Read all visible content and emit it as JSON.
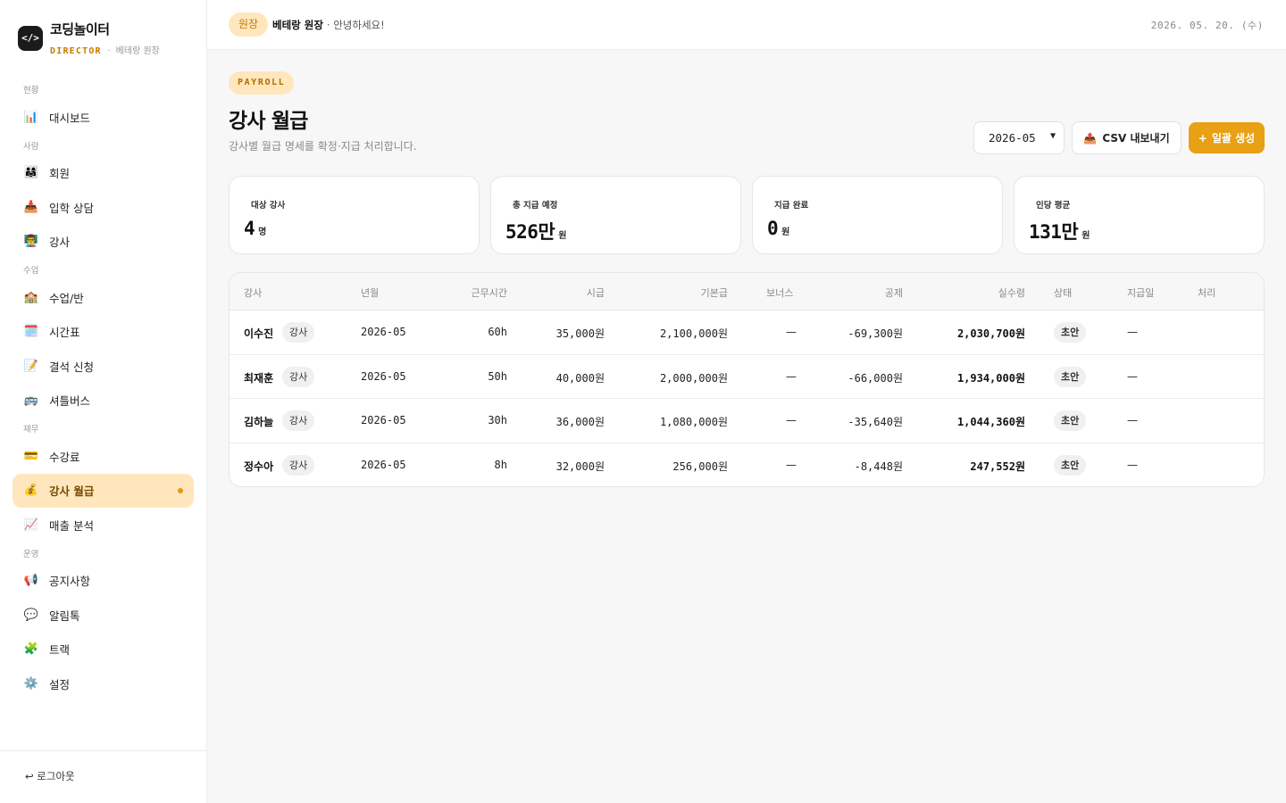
{
  "brand": {
    "logo": "</>",
    "name": "코딩놀이터",
    "role": "DIRECTOR",
    "separator": "·",
    "user": "베테랑 원장"
  },
  "nav": {
    "sections": [
      {
        "label": "현황",
        "items": [
          {
            "icon": "📊",
            "label": "대시보드"
          }
        ]
      },
      {
        "label": "사람",
        "items": [
          {
            "icon": "👨‍👩‍👧",
            "label": "회원"
          },
          {
            "icon": "📥",
            "label": "입학 상담"
          },
          {
            "icon": "👨‍🏫",
            "label": "강사"
          }
        ]
      },
      {
        "label": "수업",
        "items": [
          {
            "icon": "🏫",
            "label": "수업/반"
          },
          {
            "icon": "🗓️",
            "label": "시간표"
          },
          {
            "icon": "📝",
            "label": "결석 신청"
          },
          {
            "icon": "🚌",
            "label": "셔틀버스"
          }
        ]
      },
      {
        "label": "재무",
        "items": [
          {
            "icon": "💳",
            "label": "수강료"
          },
          {
            "icon": "💰",
            "label": "강사 월급"
          },
          {
            "icon": "📈",
            "label": "매출 분석"
          }
        ]
      },
      {
        "label": "운영",
        "items": [
          {
            "icon": "📢",
            "label": "공지사항"
          },
          {
            "icon": "💬",
            "label": "알림톡"
          },
          {
            "icon": "🧩",
            "label": "트랙"
          },
          {
            "icon": "⚙️",
            "label": "설정"
          }
        ]
      }
    ],
    "active": "강사 월급"
  },
  "logout": "↩ 로그아웃",
  "topbar": {
    "role_pill": "원장",
    "user_name": "베테랑 원장",
    "greeting": "· 안녕하세요!",
    "date": "2026. 05. 20. (수)"
  },
  "page": {
    "eyebrow": "PAYROLL",
    "title": "강사 월급",
    "description": "강사별 월급 명세를 확정·지급 처리합니다.",
    "month_value": "2026-05",
    "csv_icon": "📤",
    "csv_label": "CSV 내보내기",
    "generate_label": "일괄 생성",
    "generate_icon": "+"
  },
  "stats": [
    {
      "label": "대상 강사",
      "value": "4",
      "unit": "명"
    },
    {
      "label": "총 지급 예정",
      "value": "526만",
      "unit": "원"
    },
    {
      "label": "지급 완료",
      "value": "0",
      "unit": "원"
    },
    {
      "label": "인당 평균",
      "value": "131만",
      "unit": "원"
    }
  ],
  "table": {
    "headers": [
      "강사",
      "년월",
      "근무시간",
      "시급",
      "기본급",
      "보너스",
      "공제",
      "실수령",
      "상태",
      "지급일",
      "처리"
    ],
    "rows": [
      {
        "name": "이수진",
        "role": "강사",
        "month": "2026-05",
        "hours": "60h",
        "rate": "35,000원",
        "base": "2,100,000원",
        "bonus": "—",
        "deduction": "-69,300원",
        "net": "2,030,700원",
        "status": "초안",
        "paid": "—"
      },
      {
        "name": "최재훈",
        "role": "강사",
        "month": "2026-05",
        "hours": "50h",
        "rate": "40,000원",
        "base": "2,000,000원",
        "bonus": "—",
        "deduction": "-66,000원",
        "net": "1,934,000원",
        "status": "초안",
        "paid": "—"
      },
      {
        "name": "김하늘",
        "role": "강사",
        "month": "2026-05",
        "hours": "30h",
        "rate": "36,000원",
        "base": "1,080,000원",
        "bonus": "—",
        "deduction": "-35,640원",
        "net": "1,044,360원",
        "status": "초안",
        "paid": "—"
      },
      {
        "name": "정수아",
        "role": "강사",
        "month": "2026-05",
        "hours": "8h",
        "rate": "32,000원",
        "base": "256,000원",
        "bonus": "—",
        "deduction": "-8,448원",
        "net": "247,552원",
        "status": "초안",
        "paid": "—"
      }
    ]
  },
  "colors": {
    "accent": "#e8a014",
    "accent_soft": "#ffe6bd",
    "accent_text": "#c47d00"
  }
}
